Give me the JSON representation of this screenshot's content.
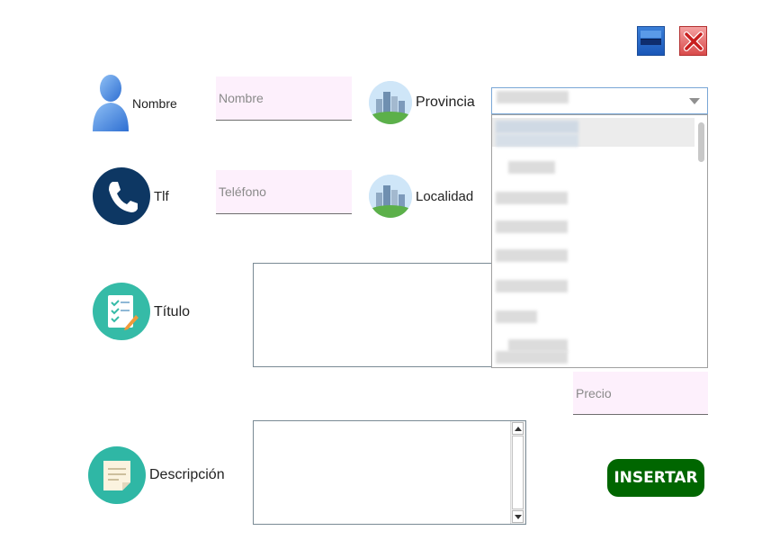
{
  "window": {
    "minimize_icon": "minimize-icon",
    "close_icon": "close-x-icon"
  },
  "form": {
    "nombre": {
      "label": "Nombre",
      "placeholder": "Nombre",
      "icon": "person-icon"
    },
    "telefono": {
      "label": "Tlf",
      "placeholder": "Teléfono",
      "icon": "phone-icon"
    },
    "provincia": {
      "label": "Provincia",
      "icon": "city-icon",
      "selected_value": ""
    },
    "localidad": {
      "label": "Localidad",
      "icon": "city-icon"
    },
    "titulo": {
      "label": "Título",
      "icon": "checklist-icon"
    },
    "precio": {
      "placeholder": "Precio"
    },
    "descripcion": {
      "label": "Descripción",
      "icon": "note-icon"
    },
    "insert_button": {
      "label": "INSERTAR",
      "color": "#006600"
    }
  },
  "colors": {
    "field_background": "#fdf0fc",
    "phone_icon_background": "#0d3763",
    "teal_icon_background": "#35bba7",
    "combo_border": "#7aa7d6"
  }
}
